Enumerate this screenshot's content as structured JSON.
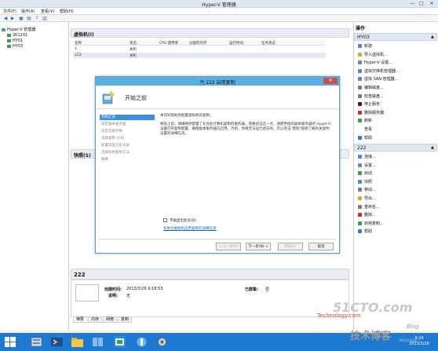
{
  "window": {
    "title": "Hyper-V 管理器",
    "min": "—",
    "max": "□",
    "close": "✕"
  },
  "menu": [
    "文件(F)",
    "操作(A)",
    "查看(V)",
    "帮助(H)"
  ],
  "tree": {
    "root": "Hyper-V 管理器",
    "nodes": [
      "2K1201",
      "HY01",
      "HY03"
    ]
  },
  "vm_panel": {
    "title": "虚拟机(I)",
    "columns": [
      "名称",
      "状态",
      "CPU 使用率",
      "分配的内存",
      "运行时间",
      "任务状态"
    ],
    "rows": [
      {
        "name": "1",
        "state": "关机"
      },
      {
        "name": "222",
        "state": "关机"
      }
    ]
  },
  "snapshot_panel": {
    "title": "快照(S)"
  },
  "detail_panel": {
    "vm_name": "222",
    "created_label": "创建时间:",
    "created_value": "2013/3/26 9:18:53",
    "notes_label": "说明:",
    "notes_value": "无",
    "clustered_label": "已群集:",
    "clustered_value": "否",
    "tabs": [
      "摘要",
      "内存",
      "网络",
      "复制"
    ]
  },
  "actions": {
    "header": "操作",
    "server_section": "HY03",
    "server_items": [
      {
        "label": "新建",
        "color": "#4f8ad1"
      },
      {
        "label": "导入虚拟机...",
        "color": "#d9a43a"
      },
      {
        "label": "Hyper-V 设置...",
        "color": "#6d87a8"
      },
      {
        "label": "虚拟交换机管理器...",
        "color": "#4f8ad1"
      },
      {
        "label": "虚拟 SAN 管理器...",
        "color": "#4f8ad1"
      },
      {
        "label": "编辑磁盘...",
        "color": "#7b7b7b"
      },
      {
        "label": "检查磁盘...",
        "color": "#7b7b7b"
      },
      {
        "label": "停止服务",
        "color": "#2b2b2b"
      },
      {
        "label": "删除服务器",
        "color": "#c9302c"
      },
      {
        "label": "刷新",
        "color": "#3aa04a"
      },
      {
        "label": "查看",
        "color": "#ffffff"
      },
      {
        "label": "帮助",
        "color": "#2c7bd6"
      }
    ],
    "vm_section": "222",
    "vm_items": [
      {
        "label": "连接...",
        "color": "#4f8ad1"
      },
      {
        "label": "设置...",
        "color": "#6d87a8"
      },
      {
        "label": "启动",
        "color": "#3aa04a"
      },
      {
        "label": "快照",
        "color": "#4f8ad1"
      },
      {
        "label": "移动...",
        "color": "#7b7b7b"
      },
      {
        "label": "导出...",
        "color": "#d9a43a"
      },
      {
        "label": "重命名...",
        "color": "#7b7b7b"
      },
      {
        "label": "删除...",
        "color": "#c9302c"
      },
      {
        "label": "启用复制...",
        "color": "#3aa04a"
      },
      {
        "label": "帮助",
        "color": "#2c7bd6"
      }
    ]
  },
  "dialog": {
    "title": "为 222 启用复制",
    "close": "✕",
    "heading": "开始之前",
    "steps": [
      "开始之前",
      "指定副本服务器",
      "指定连接参数",
      "选择复制 VHD",
      "配置恢复历史记录",
      "选择初始复制方法",
      "摘要"
    ],
    "current_step": 0,
    "intro": "本向导帮助你配置虚拟机的复制。",
    "body": "继续之前，请确保你配置了允许此计算机复制的服务器，而要验证这一点，请使用指向副本服务器的 Hyper-V 设置打开复制配置，确保副本服务器已启用。否则，你将无法运行此向导。可以单击\"帮助\"链接了解有关复制设置的详细信息。",
    "skip_label": "不再显示此页(D)",
    "link": "有关为虚拟机启用复制的详细信息",
    "buttons": {
      "prev": "< 上一步(P)",
      "next": "下一步(N) >",
      "finish": "完成(F)",
      "cancel": "取消"
    }
  },
  "taskbar": {
    "time": "9:24",
    "date": "2013/3/26"
  },
  "watermark": {
    "line1": "51CTO.com",
    "line2": "Technology.com",
    "line3": "技术博客",
    "line4": "Blog",
    "line5": "2013/3/26"
  }
}
